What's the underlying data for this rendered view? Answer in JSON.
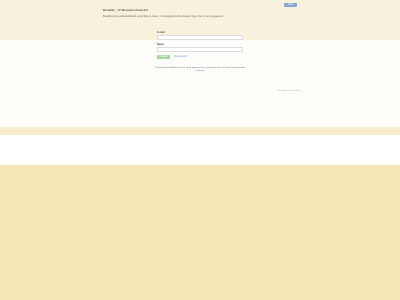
{
  "header": {
    "fb_button": "Like",
    "title": "Breakfly - 17 Mercatorstraat Ant",
    "intro": "Breakfly is dé social dashboard e-mail lists op maat - Om toegang tot dit onderdeel, log je hier in met je gegevens."
  },
  "form": {
    "email_label": "E-mail",
    "email_value": "",
    "password_label": "Naam",
    "password_value": "",
    "submit_label": "Inloggen",
    "forgot_link": "Wachtwoord?"
  },
  "notice": "Om je data beschikbaar te zien op de pagina's kan je dit vinden. Kan niet liever je contactinfo naar ons.",
  "side_note": "Breakfly Inc. Nederland"
}
